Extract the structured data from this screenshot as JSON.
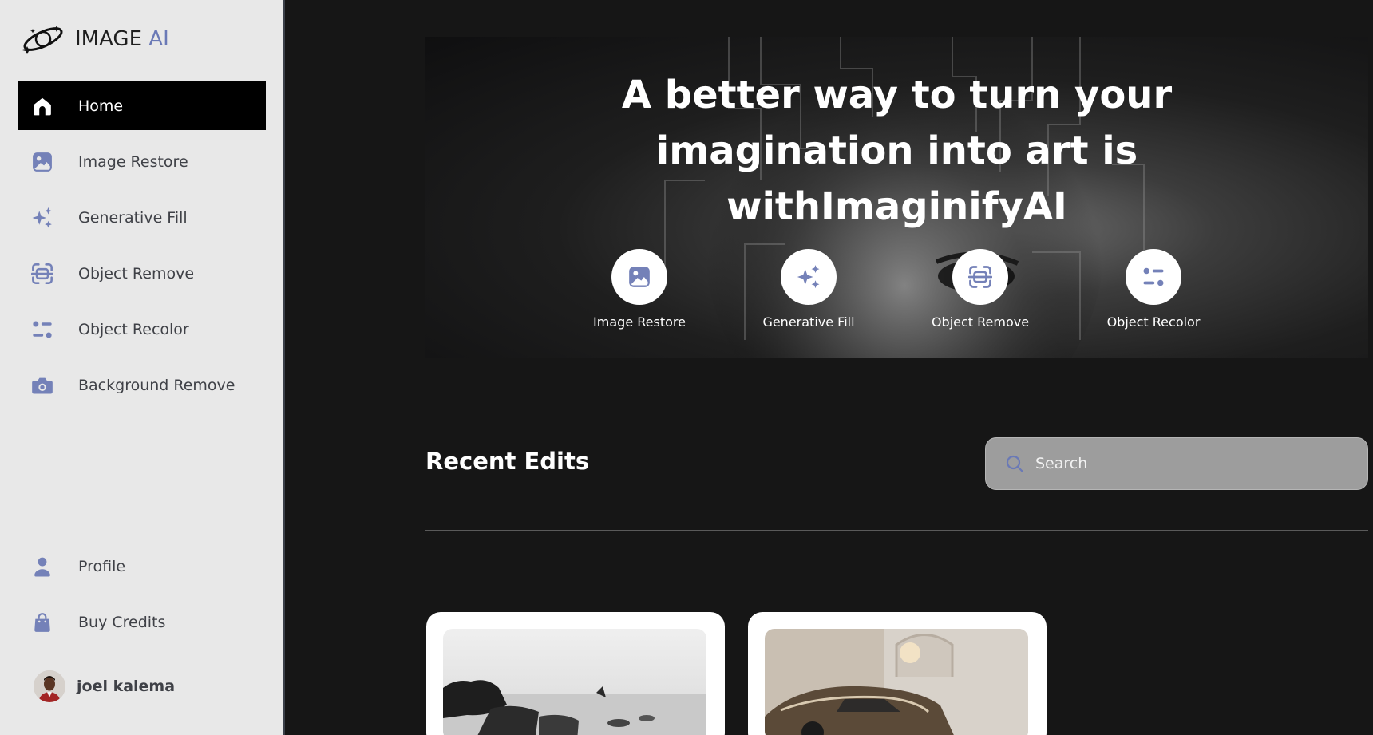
{
  "brand": {
    "name": "IMAGE",
    "accent": "AI",
    "accent_color": "#6a79b6"
  },
  "sidebar": {
    "items": [
      {
        "label": "Home",
        "icon": "home-icon",
        "active": true
      },
      {
        "label": "Image Restore",
        "icon": "image-icon",
        "active": false
      },
      {
        "label": "Generative Fill",
        "icon": "sparkles-icon",
        "active": false
      },
      {
        "label": "Object Remove",
        "icon": "scan-icon",
        "active": false
      },
      {
        "label": "Object Recolor",
        "icon": "filter-icon",
        "active": false
      },
      {
        "label": "Background Remove",
        "icon": "camera-icon",
        "active": false
      }
    ],
    "bottom_items": [
      {
        "label": "Profile",
        "icon": "user-icon"
      },
      {
        "label": "Buy Credits",
        "icon": "shopping-bag-icon"
      }
    ],
    "user": {
      "name": "joel kalema"
    }
  },
  "hero": {
    "title_line1": "A better way to turn your",
    "title_line2": "imagination into art is",
    "title_line3": "withImaginifyAI",
    "tools": [
      {
        "label": "Image Restore",
        "icon": "image-icon"
      },
      {
        "label": "Generative Fill",
        "icon": "sparkles-icon"
      },
      {
        "label": "Object Remove",
        "icon": "scan-icon"
      },
      {
        "label": "Object Recolor",
        "icon": "filter-icon"
      }
    ]
  },
  "recent": {
    "title": "Recent Edits",
    "search_placeholder": "Search"
  }
}
